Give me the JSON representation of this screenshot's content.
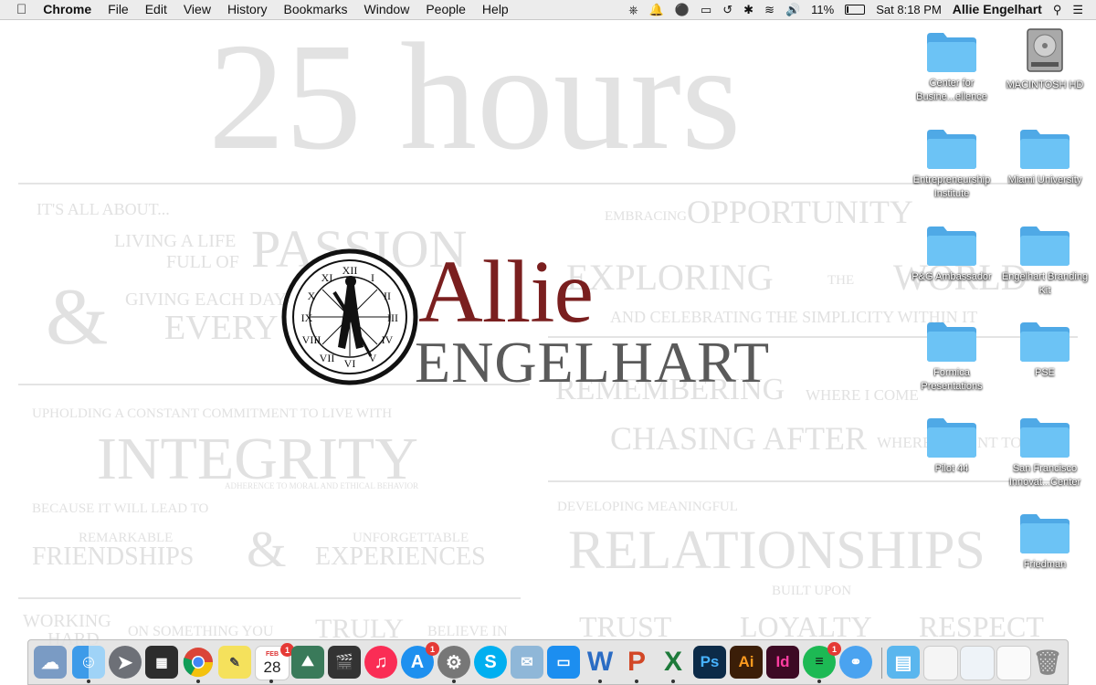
{
  "menubar": {
    "app_name": "Chrome",
    "menus": [
      "File",
      "Edit",
      "View",
      "History",
      "Bookmarks",
      "Window",
      "People",
      "Help"
    ],
    "battery": "11%",
    "clock": "Sat 8:18 PM",
    "user": "Allie Engelhart"
  },
  "wallpaper": {
    "hours": "25 hours",
    "its_all_about": "IT'S ALL ABOUT...",
    "living_a_life": "LIVING A LIFE",
    "full_of": "FULL OF",
    "passion": "PASSION",
    "amp1": "&",
    "giving_each_day": "GIVING EACH DAY",
    "every": "EVERY",
    "embracing": "EMBRACING",
    "opportunity": "OPPORTUNITY",
    "exploring": "EXPLORING",
    "the": "THE",
    "world": "WORLD",
    "and_celebrating": "AND CELEBRATING THE SIMPLICITY WITHIN IT",
    "remembering": "REMEMBERING",
    "where_i_come": "WHERE I COME",
    "chasing_after": "CHASING AFTER",
    "where": "WHERE",
    "nt_to": "NT TO",
    "upholding": "UPHOLDING A CONSTANT COMMITMENT TO LIVE WITH",
    "integrity": "INTEGRITY",
    "adherence": "ADHERENCE TO MORAL AND ETHICAL BEHAVIOR",
    "because": "BECAUSE IT WILL LEAD TO",
    "remarkable": "REMARKABLE",
    "friendships": "FRIENDSHIPS",
    "amp2": "&",
    "unforgettable": "UNFORGETTABLE",
    "experiences": "EXPERIENCES",
    "developing": "DEVELOPING MEANINGFUL",
    "relationships": "RELATIONSHIPS",
    "built_upon": "BUILT UPON",
    "working": "WORKING",
    "hard": "HARD",
    "on_something": "ON SOMETHING YOU",
    "truly": "TRULY",
    "believe_in": "BELIEVE IN",
    "trust": "TRUST",
    "loyalty": "LOYALTY",
    "respect": "RESPECT"
  },
  "logo": {
    "first": "Allie",
    "last": "ENGELHART"
  },
  "desktop_icons": [
    {
      "label": "Center for Busine...ellence",
      "kind": "folder"
    },
    {
      "label": "MACINTOSH HD",
      "kind": "drive"
    },
    {
      "label": "Entrepreneurship Institute",
      "kind": "folder"
    },
    {
      "label": "Miami University",
      "kind": "folder"
    },
    {
      "label": "P&G Ambassador",
      "kind": "folder"
    },
    {
      "label": "Engelhart Branding Kit",
      "kind": "folder"
    },
    {
      "label": "Formica Presentations",
      "kind": "folder"
    },
    {
      "label": "PSE",
      "kind": "folder"
    },
    {
      "label": "Pilot 44",
      "kind": "folder"
    },
    {
      "label": "San Francisco Innovat...Center",
      "kind": "folder"
    },
    {
      "label": "Friedman",
      "kind": "folder"
    }
  ],
  "dock": {
    "calendar_month": "FEB",
    "calendar_day": "28",
    "calendar_badge": "1",
    "appstore_badge": "1",
    "spotify_badge": "1",
    "word_letter": "W",
    "ppt_letter": "P",
    "excel_letter": "X",
    "ps_letter": "Ps",
    "ai_letter": "Ai",
    "id_letter": "Id",
    "skype_letter": "S"
  },
  "colors": {
    "logo_red": "#7a1f1f",
    "logo_gray": "#5a5a5a",
    "folder_blue": "#5ab6ee"
  }
}
